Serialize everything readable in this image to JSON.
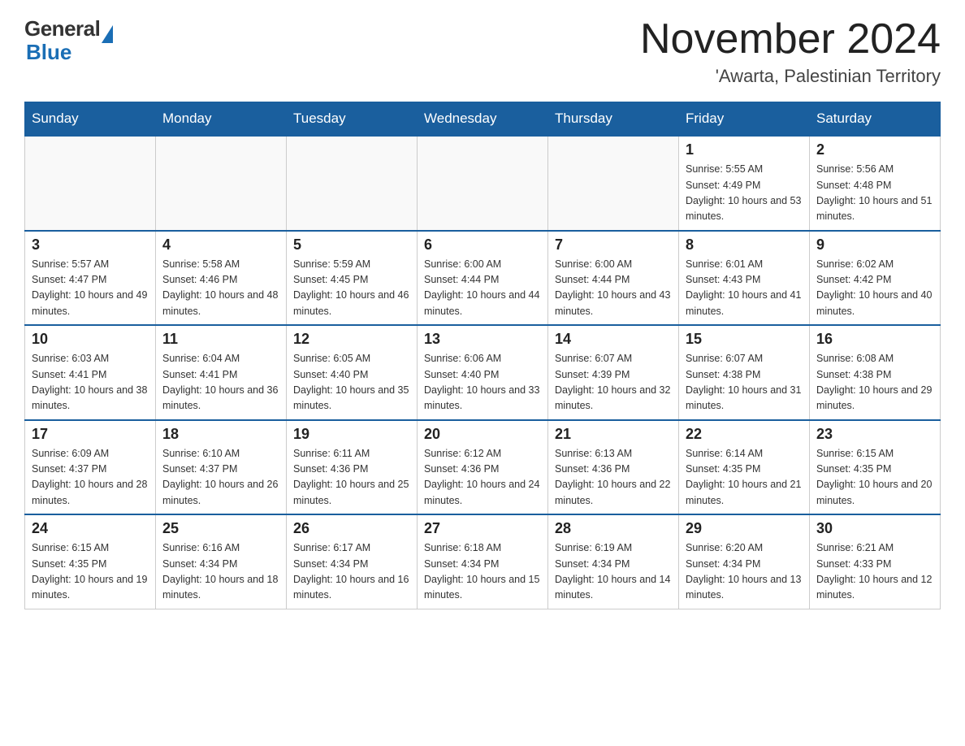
{
  "header": {
    "logo": {
      "general": "General",
      "blue": "Blue"
    },
    "title": "November 2024",
    "location": "'Awarta, Palestinian Territory"
  },
  "weekdays": [
    "Sunday",
    "Monday",
    "Tuesday",
    "Wednesday",
    "Thursday",
    "Friday",
    "Saturday"
  ],
  "weeks": [
    [
      {
        "day": "",
        "sunrise": "",
        "sunset": "",
        "daylight": ""
      },
      {
        "day": "",
        "sunrise": "",
        "sunset": "",
        "daylight": ""
      },
      {
        "day": "",
        "sunrise": "",
        "sunset": "",
        "daylight": ""
      },
      {
        "day": "",
        "sunrise": "",
        "sunset": "",
        "daylight": ""
      },
      {
        "day": "",
        "sunrise": "",
        "sunset": "",
        "daylight": ""
      },
      {
        "day": "1",
        "sunrise": "Sunrise: 5:55 AM",
        "sunset": "Sunset: 4:49 PM",
        "daylight": "Daylight: 10 hours and 53 minutes."
      },
      {
        "day": "2",
        "sunrise": "Sunrise: 5:56 AM",
        "sunset": "Sunset: 4:48 PM",
        "daylight": "Daylight: 10 hours and 51 minutes."
      }
    ],
    [
      {
        "day": "3",
        "sunrise": "Sunrise: 5:57 AM",
        "sunset": "Sunset: 4:47 PM",
        "daylight": "Daylight: 10 hours and 49 minutes."
      },
      {
        "day": "4",
        "sunrise": "Sunrise: 5:58 AM",
        "sunset": "Sunset: 4:46 PM",
        "daylight": "Daylight: 10 hours and 48 minutes."
      },
      {
        "day": "5",
        "sunrise": "Sunrise: 5:59 AM",
        "sunset": "Sunset: 4:45 PM",
        "daylight": "Daylight: 10 hours and 46 minutes."
      },
      {
        "day": "6",
        "sunrise": "Sunrise: 6:00 AM",
        "sunset": "Sunset: 4:44 PM",
        "daylight": "Daylight: 10 hours and 44 minutes."
      },
      {
        "day": "7",
        "sunrise": "Sunrise: 6:00 AM",
        "sunset": "Sunset: 4:44 PM",
        "daylight": "Daylight: 10 hours and 43 minutes."
      },
      {
        "day": "8",
        "sunrise": "Sunrise: 6:01 AM",
        "sunset": "Sunset: 4:43 PM",
        "daylight": "Daylight: 10 hours and 41 minutes."
      },
      {
        "day": "9",
        "sunrise": "Sunrise: 6:02 AM",
        "sunset": "Sunset: 4:42 PM",
        "daylight": "Daylight: 10 hours and 40 minutes."
      }
    ],
    [
      {
        "day": "10",
        "sunrise": "Sunrise: 6:03 AM",
        "sunset": "Sunset: 4:41 PM",
        "daylight": "Daylight: 10 hours and 38 minutes."
      },
      {
        "day": "11",
        "sunrise": "Sunrise: 6:04 AM",
        "sunset": "Sunset: 4:41 PM",
        "daylight": "Daylight: 10 hours and 36 minutes."
      },
      {
        "day": "12",
        "sunrise": "Sunrise: 6:05 AM",
        "sunset": "Sunset: 4:40 PM",
        "daylight": "Daylight: 10 hours and 35 minutes."
      },
      {
        "day": "13",
        "sunrise": "Sunrise: 6:06 AM",
        "sunset": "Sunset: 4:40 PM",
        "daylight": "Daylight: 10 hours and 33 minutes."
      },
      {
        "day": "14",
        "sunrise": "Sunrise: 6:07 AM",
        "sunset": "Sunset: 4:39 PM",
        "daylight": "Daylight: 10 hours and 32 minutes."
      },
      {
        "day": "15",
        "sunrise": "Sunrise: 6:07 AM",
        "sunset": "Sunset: 4:38 PM",
        "daylight": "Daylight: 10 hours and 31 minutes."
      },
      {
        "day": "16",
        "sunrise": "Sunrise: 6:08 AM",
        "sunset": "Sunset: 4:38 PM",
        "daylight": "Daylight: 10 hours and 29 minutes."
      }
    ],
    [
      {
        "day": "17",
        "sunrise": "Sunrise: 6:09 AM",
        "sunset": "Sunset: 4:37 PM",
        "daylight": "Daylight: 10 hours and 28 minutes."
      },
      {
        "day": "18",
        "sunrise": "Sunrise: 6:10 AM",
        "sunset": "Sunset: 4:37 PM",
        "daylight": "Daylight: 10 hours and 26 minutes."
      },
      {
        "day": "19",
        "sunrise": "Sunrise: 6:11 AM",
        "sunset": "Sunset: 4:36 PM",
        "daylight": "Daylight: 10 hours and 25 minutes."
      },
      {
        "day": "20",
        "sunrise": "Sunrise: 6:12 AM",
        "sunset": "Sunset: 4:36 PM",
        "daylight": "Daylight: 10 hours and 24 minutes."
      },
      {
        "day": "21",
        "sunrise": "Sunrise: 6:13 AM",
        "sunset": "Sunset: 4:36 PM",
        "daylight": "Daylight: 10 hours and 22 minutes."
      },
      {
        "day": "22",
        "sunrise": "Sunrise: 6:14 AM",
        "sunset": "Sunset: 4:35 PM",
        "daylight": "Daylight: 10 hours and 21 minutes."
      },
      {
        "day": "23",
        "sunrise": "Sunrise: 6:15 AM",
        "sunset": "Sunset: 4:35 PM",
        "daylight": "Daylight: 10 hours and 20 minutes."
      }
    ],
    [
      {
        "day": "24",
        "sunrise": "Sunrise: 6:15 AM",
        "sunset": "Sunset: 4:35 PM",
        "daylight": "Daylight: 10 hours and 19 minutes."
      },
      {
        "day": "25",
        "sunrise": "Sunrise: 6:16 AM",
        "sunset": "Sunset: 4:34 PM",
        "daylight": "Daylight: 10 hours and 18 minutes."
      },
      {
        "day": "26",
        "sunrise": "Sunrise: 6:17 AM",
        "sunset": "Sunset: 4:34 PM",
        "daylight": "Daylight: 10 hours and 16 minutes."
      },
      {
        "day": "27",
        "sunrise": "Sunrise: 6:18 AM",
        "sunset": "Sunset: 4:34 PM",
        "daylight": "Daylight: 10 hours and 15 minutes."
      },
      {
        "day": "28",
        "sunrise": "Sunrise: 6:19 AM",
        "sunset": "Sunset: 4:34 PM",
        "daylight": "Daylight: 10 hours and 14 minutes."
      },
      {
        "day": "29",
        "sunrise": "Sunrise: 6:20 AM",
        "sunset": "Sunset: 4:34 PM",
        "daylight": "Daylight: 10 hours and 13 minutes."
      },
      {
        "day": "30",
        "sunrise": "Sunrise: 6:21 AM",
        "sunset": "Sunset: 4:33 PM",
        "daylight": "Daylight: 10 hours and 12 minutes."
      }
    ]
  ]
}
